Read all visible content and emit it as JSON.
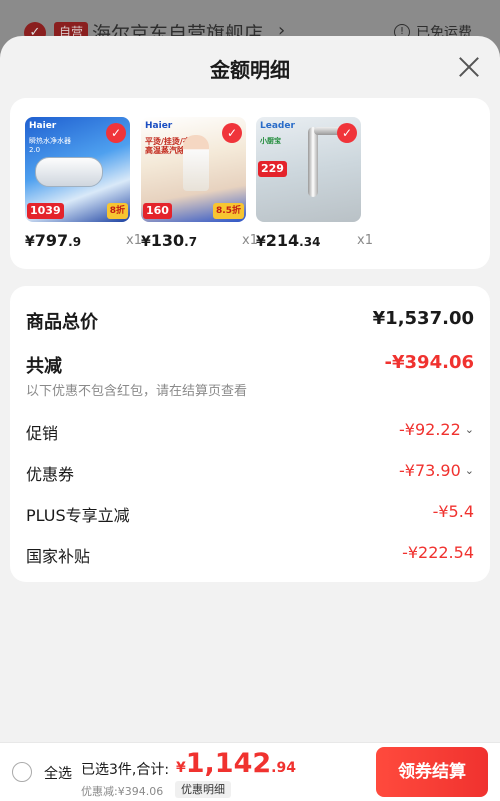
{
  "background": {
    "check_glyph": "✓",
    "badge": "自营",
    "store_name": "海尔京东自营旗舰店",
    "chevron": "›",
    "info_glyph": "!",
    "shipping": "已免运费"
  },
  "sheet": {
    "title": "金额明细",
    "close_icon": "close-icon"
  },
  "products": [
    {
      "brand": "Haier",
      "tagline": "瞬热水净水器2.0",
      "image_price": "1039",
      "promo": "8折",
      "price_currency": "¥",
      "price_int": "797",
      "price_dec": ".9",
      "qty": "x1"
    },
    {
      "brand": "Haier",
      "tagline": "平烫/挂烫/衣架 高温蒸汽除菌",
      "image_price": "160",
      "promo": "8.5折",
      "price_currency": "¥",
      "price_int": "130",
      "price_dec": ".7",
      "qty": "x1"
    },
    {
      "brand": "Leader",
      "tagline": "小厨宝",
      "image_price": "229",
      "promo": "",
      "price_currency": "¥",
      "price_int": "214",
      "price_dec": ".34",
      "qty": "x1"
    }
  ],
  "summary": {
    "total_label": "商品总价",
    "total_value": "¥1,537.00",
    "reduce_label": "共减",
    "reduce_value": "-¥394.06",
    "note": "以下优惠不包含红包，请在结算页查看",
    "items": [
      {
        "label": "促销",
        "value": "-¥92.22",
        "has_chevron": true
      },
      {
        "label": "优惠券",
        "value": "-¥73.90",
        "has_chevron": true
      },
      {
        "label": "PLUS专享立减",
        "value": "-¥5.4",
        "has_chevron": false
      },
      {
        "label": "国家补贴",
        "value": "-¥222.54",
        "has_chevron": false
      }
    ],
    "chevron_glyph": "⌄"
  },
  "footer": {
    "select_all": "全选",
    "selected_text": "已选3件,合计:",
    "total_currency": "¥",
    "total_int": "1,142",
    "total_dec": ".94",
    "discount_note": "优惠减:¥394.06",
    "detail_chip": "优惠明细",
    "checkout": "领券结算"
  },
  "colors": {
    "accent_red": "#f0322f",
    "text_dark": "#1a1a1a",
    "text_grey": "#8a8a8a",
    "sheet_bg": "#f2f2f2"
  }
}
